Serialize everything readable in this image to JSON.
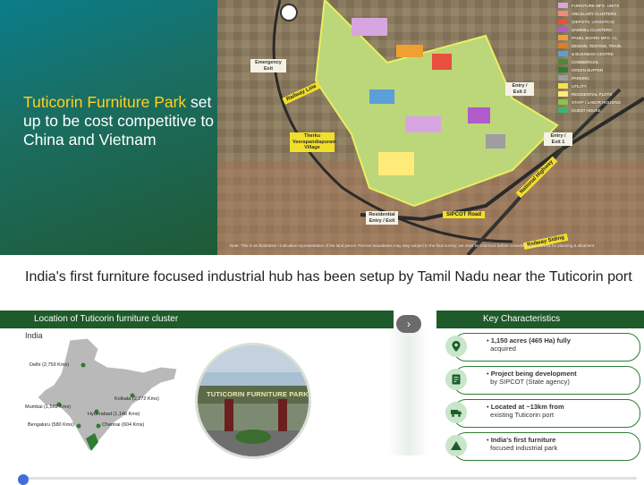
{
  "hero": {
    "title_highlight": "Tuticorin Furniture Park",
    "title_rest": " set up to be cost competitive to China and Vietnam"
  },
  "map": {
    "labels": {
      "emergency_exit": "Emergency Exit",
      "railway_line": "Railway Line",
      "village": "Therku Veerapandiapuram Village",
      "entry_exit_2": "Entry / Exit 2",
      "entry_exit_1": "Entry / Exit 1",
      "national_highway": "National Highway",
      "sipcot_road": "SIPCOT Road",
      "residential_entry": "Residential Entry / Exit",
      "railway_siding": "Railway Siding"
    },
    "note": "Note: This is an illustrative / indicative representation of the land parcel. Precise boundaries may vary subject to the final survey; we must be informed before considering the current for planning & allotment.",
    "legend": [
      {
        "label": "FURNITURE MFG. UNITS",
        "color": "#d7a6e0"
      },
      {
        "label": "ANCILLARY CLUSTERS",
        "color": "#f28b7d"
      },
      {
        "label": "(DEPOTS, LOGISTICS)",
        "color": "#e84f3d"
      },
      {
        "label": "SAWMILL CLUSTERS",
        "color": "#b05bc9"
      },
      {
        "label": "PANEL BOARD MFG. CL.",
        "color": "#f0a030"
      },
      {
        "label": "DESIGN, TESTING, TRAIN.",
        "color": "#e07b2a"
      },
      {
        "label": "& BUSINESS CENTRE",
        "color": "#5a9fd8"
      },
      {
        "label": "COMMERCIAL",
        "color": "#4a8a3a"
      },
      {
        "label": "GREEN BUFFER",
        "color": "#2e7d32"
      },
      {
        "label": "PARKING",
        "color": "#9e9e9e"
      },
      {
        "label": "UTILITY",
        "color": "#f6e24a"
      },
      {
        "label": "RESIDENTIAL PLOTS",
        "color": "#ffeb7a"
      },
      {
        "label": "STAFF / LABOR HOUSING",
        "color": "#8bc34a"
      },
      {
        "label": "GUEST HOUSE",
        "color": "#3cb371"
      }
    ]
  },
  "headline": "India's first furniture focused industrial hub has been setup by Tamil Nadu near the Tuticorin port",
  "location": {
    "header": "Location of Tuticorin furniture cluster",
    "country": "India",
    "cities": [
      {
        "label": "Delhi (2,759 Kms)"
      },
      {
        "label": "Kolkata (2,272 Kms)"
      },
      {
        "label": "Mumbai (1,569 Kms)"
      },
      {
        "label": "Hyderabad (1,146 Kms)"
      },
      {
        "label": "Bengaluru (580 Kms)"
      },
      {
        "label": "Chennai (604 Kms)"
      }
    ],
    "photo_sign": "TUTICORIN FURNITURE PARK"
  },
  "key": {
    "header": "Key Characteristics",
    "items": [
      {
        "bold": "1,150 acres (465 Ha) fully",
        "rest": "acquired",
        "icon": "location-pin-icon"
      },
      {
        "bold": "Project being development",
        "rest": "by SIPCOT (State agency)",
        "icon": "document-icon"
      },
      {
        "bold": "Located at ~13km from",
        "rest": "existing Tuticorin port",
        "icon": "truck-icon"
      },
      {
        "bold": "India's first furniture",
        "rest": "focused industrial park",
        "icon": "triangle-icon"
      }
    ]
  },
  "colors": {
    "header_green": "#1f5a2a",
    "highlight_yellow": "#ffd21f",
    "accent_green": "#2e7d32"
  }
}
